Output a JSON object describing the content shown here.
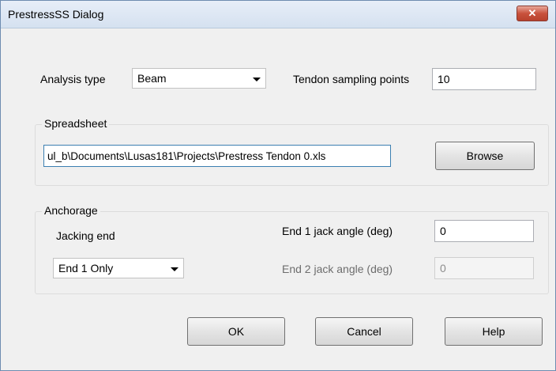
{
  "window": {
    "title": "PrestressSS Dialog",
    "close_glyph": "✕"
  },
  "analysis": {
    "label": "Analysis type",
    "selected": "Beam"
  },
  "tendon": {
    "label": "Tendon sampling points",
    "value": "10"
  },
  "spreadsheet": {
    "legend": "Spreadsheet",
    "path": "ul_b\\Documents\\Lusas181\\Projects\\Prestress Tendon 0.xls",
    "browse_label": "Browse"
  },
  "anchorage": {
    "legend": "Anchorage",
    "jacking_label": "Jacking end",
    "jacking_selected": "End 1 Only",
    "end1_label": "End 1 jack angle (deg)",
    "end1_value": "0",
    "end2_label": "End 2 jack angle (deg)",
    "end2_value": "0"
  },
  "buttons": {
    "ok": "OK",
    "cancel": "Cancel",
    "help": "Help"
  }
}
